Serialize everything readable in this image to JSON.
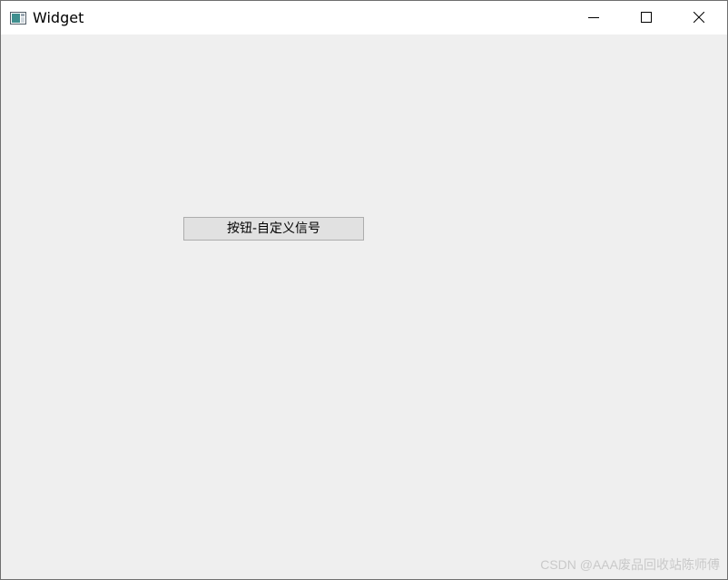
{
  "window": {
    "title": "Widget",
    "app_icon": "qt-widget-app-icon",
    "caption_buttons": {
      "minimize": "minimize-icon",
      "maximize": "maximize-icon",
      "close": "close-icon"
    }
  },
  "main": {
    "custom_signal_button_label": "按钮-自定义信号"
  },
  "watermark": {
    "text": "CSDN @AAA废品回收站陈师傅"
  },
  "colors": {
    "titlebar_bg": "#ffffff",
    "client_bg": "#efefef",
    "button_bg": "#e1e1e1",
    "button_border": "#adadad"
  }
}
